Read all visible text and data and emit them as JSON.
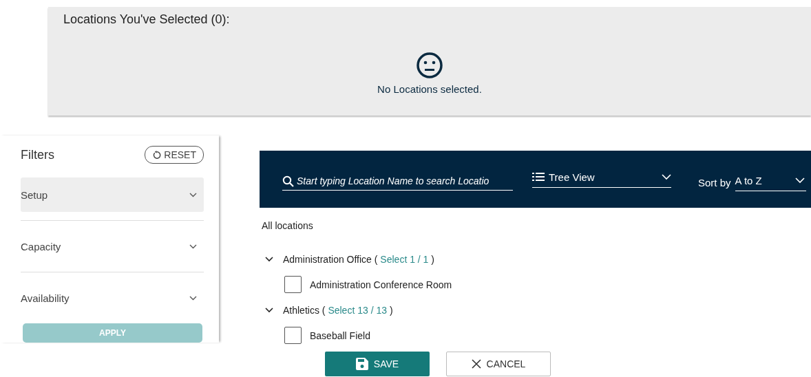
{
  "selected_panel": {
    "title": "Locations You've Selected (0):",
    "empty_message": "No Locations selected."
  },
  "filters": {
    "title": "Filters",
    "reset_label": "RESET",
    "items": [
      {
        "label": "Setup",
        "highlighted": true,
        "expanded": false
      },
      {
        "label": "Capacity",
        "highlighted": false,
        "expanded": false
      },
      {
        "label": "Availability",
        "highlighted": false,
        "expanded": false
      }
    ],
    "apply_label": "APPLY",
    "apply_disabled": true
  },
  "toolbar": {
    "search_placeholder": "Start typing Location Name to search Locatio",
    "view": "Tree View",
    "sort_label": "Sort by",
    "sort": "A to Z"
  },
  "tree": {
    "root": "All locations",
    "groups": [
      {
        "name": "Administration Office",
        "paren_open": "(",
        "select_text": "Select 1 / 1",
        "paren_close": ")",
        "expanded": true,
        "children": [
          {
            "name": "Administration Conference Room",
            "checked": false
          }
        ]
      },
      {
        "name": "Athletics",
        "paren_open": "(",
        "select_text": "Select 13 / 13",
        "paren_close": ")",
        "expanded": true,
        "children": [
          {
            "name": "Baseball Field",
            "checked": false
          }
        ]
      }
    ]
  },
  "buttons": [
    {
      "kind": "save",
      "label": "SAVE"
    },
    {
      "kind": "cancel",
      "label": "CANCEL"
    }
  ]
}
